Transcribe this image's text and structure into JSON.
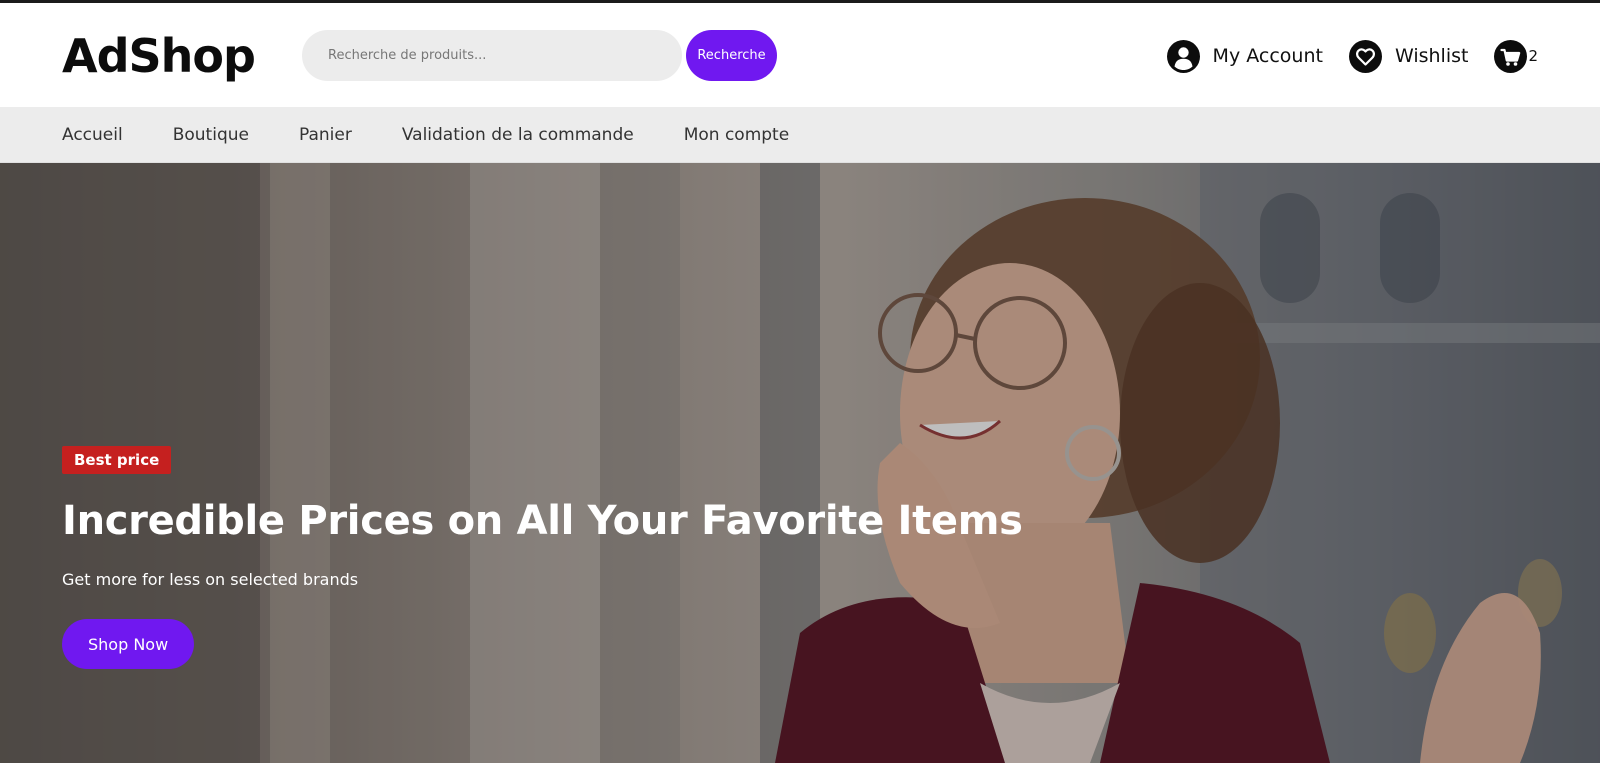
{
  "brand": {
    "logo_text": "AdShop"
  },
  "search": {
    "placeholder": "Recherche de produits...",
    "button_label": "Recherche"
  },
  "header_actions": {
    "account_label": "My Account",
    "wishlist_label": "Wishlist",
    "cart_count": "2"
  },
  "nav": {
    "items": [
      {
        "label": "Accueil"
      },
      {
        "label": "Boutique"
      },
      {
        "label": "Panier"
      },
      {
        "label": "Validation de la commande"
      },
      {
        "label": "Mon compte"
      }
    ]
  },
  "hero": {
    "badge": "Best price",
    "title": "Incredible Prices on All Your Favorite Items",
    "subtitle": "Get more for less on selected brands",
    "cta_label": "Shop Now"
  },
  "colors": {
    "accent": "#7018f0",
    "badge": "#c5201f",
    "nav_background": "#ececec",
    "icon": "#0c0c0c"
  },
  "icons": {
    "account": "user-icon",
    "wishlist": "heart-icon",
    "cart": "cart-icon"
  }
}
